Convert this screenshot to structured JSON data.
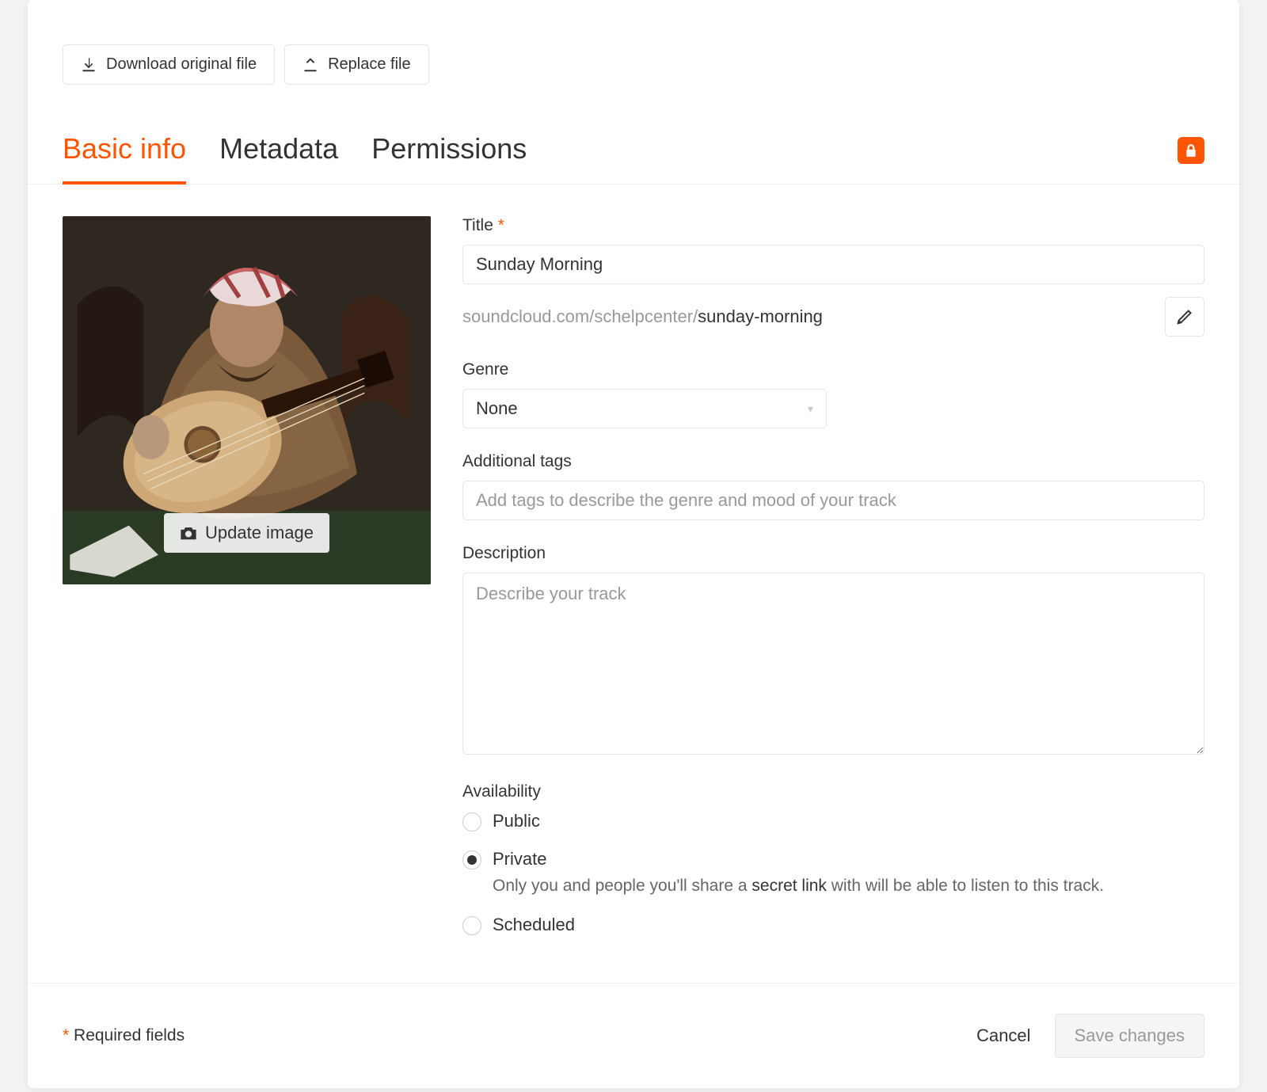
{
  "top": {
    "download_label": "Download original file",
    "replace_label": "Replace file"
  },
  "tabs": {
    "items": [
      {
        "label": "Basic info",
        "active": true
      },
      {
        "label": "Metadata",
        "active": false
      },
      {
        "label": "Permissions",
        "active": false
      }
    ]
  },
  "artwork": {
    "update_label": "Update image"
  },
  "form": {
    "title": {
      "label": "Title",
      "value": "Sunday Morning"
    },
    "permalink": {
      "domain": "soundcloud.com/schelpcenter/",
      "slug": "sunday-morning"
    },
    "genre": {
      "label": "Genre",
      "value": "None"
    },
    "tags": {
      "label": "Additional tags",
      "placeholder": "Add tags to describe the genre and mood of your track"
    },
    "description": {
      "label": "Description",
      "placeholder": "Describe your track"
    },
    "availability": {
      "label": "Availability",
      "options": [
        {
          "label": "Public"
        },
        {
          "label": "Private",
          "selected": true,
          "desc_before": "Only you and people you'll share a ",
          "desc_link": "secret link",
          "desc_after": " with will be able to listen to this track."
        },
        {
          "label": "Scheduled"
        }
      ]
    }
  },
  "footer": {
    "required_label": "Required fields",
    "cancel_label": "Cancel",
    "save_label": "Save changes"
  }
}
